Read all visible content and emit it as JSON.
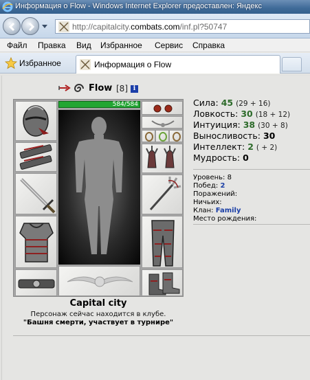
{
  "window": {
    "title": "Информация о Flow - Windows Internet Explorer предоставлен: Яндекс"
  },
  "address": {
    "url_prefix": "http://capitalcity.",
    "url_domain": "combats.com",
    "url_path": "/inf.pl?50747"
  },
  "menu": [
    "Файл",
    "Правка",
    "Вид",
    "Избранное",
    "Сервис",
    "Справка"
  ],
  "tabs": {
    "favorites_label": "Избранное",
    "active_tab_label": "Информация о Flow"
  },
  "character": {
    "name": "Flow",
    "level_badge": "[8]",
    "info_icon_letter": "i",
    "hp_text": "584/584",
    "hp_fraction": 1.0
  },
  "location": {
    "city": "Capital city",
    "status": "Персонаж сейчас находится в клубе.",
    "place": "\"Башня смерти, участвует в турнире\""
  },
  "stats": [
    {
      "label": "Сила:",
      "value": "45",
      "extra": "(29 + 16)",
      "color": "green"
    },
    {
      "label": "Ловкость:",
      "value": "30",
      "extra": "(18 + 12)",
      "color": "green"
    },
    {
      "label": "Интуиция:",
      "value": "38",
      "extra": "(30 + 8)",
      "color": "green"
    },
    {
      "label": "Выносливость:",
      "value": "30",
      "extra": "",
      "color": "black"
    },
    {
      "label": "Интеллект:",
      "value": "2",
      "extra": "( + 2)",
      "color": "green"
    },
    {
      "label": "Мудрость:",
      "value": "0",
      "extra": "",
      "color": "black"
    }
  ],
  "details": {
    "level_label": "Уровень:",
    "level_value": "8",
    "wins_label": "Побед:",
    "wins_value": "2",
    "losses_label": "Поражений:",
    "draws_label": "Ничьих:",
    "clan_label": "Клан:",
    "clan_value": "Family",
    "birthplace_label": "Место рождения:"
  },
  "colors": {
    "stat_green": "#2d6b2a",
    "hp_green": "#23a633",
    "link_blue": "#1a3ea6"
  }
}
